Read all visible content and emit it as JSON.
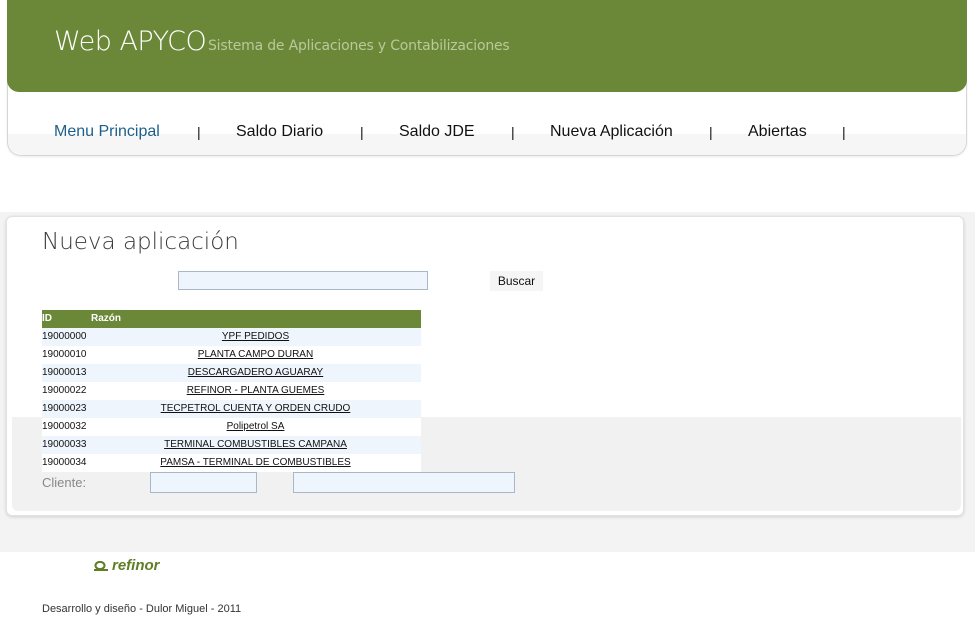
{
  "header": {
    "app_title": "Web APYCO",
    "app_subtitle": "Sistema de Aplicaciones y Contabilizaciones"
  },
  "nav": {
    "items": [
      {
        "label": "Menu Principal",
        "active": true
      },
      {
        "label": "Saldo Diario",
        "active": false
      },
      {
        "label": "Saldo JDE",
        "active": false
      },
      {
        "label": "Nueva Aplicación",
        "active": false
      },
      {
        "label": "Abiertas",
        "active": false
      }
    ],
    "separator": "|"
  },
  "page": {
    "title": "Nueva aplicación",
    "search_value": "",
    "search_button": "Buscar"
  },
  "table": {
    "columns": [
      "ID",
      "Razón"
    ],
    "rows": [
      {
        "id": "19000000",
        "name": "YPF PEDIDOS"
      },
      {
        "id": "19000010",
        "name": "PLANTA CAMPO DURAN"
      },
      {
        "id": "19000013",
        "name": "DESCARGADERO AGUARAY"
      },
      {
        "id": "19000022",
        "name": "REFINOR - PLANTA GUEMES"
      },
      {
        "id": "19000023",
        "name": "TECPETROL  CUENTA Y ORDEN CRUDO"
      },
      {
        "id": "19000032",
        "name": "Polipetrol SA"
      },
      {
        "id": "19000033",
        "name": "TERMINAL COMBUSTIBLES CAMPANA"
      },
      {
        "id": "19000034",
        "name": "PAMSA - TERMINAL DE COMBUSTIBLES"
      }
    ]
  },
  "cliente": {
    "label": "Cliente:",
    "code_value": "",
    "name_value": ""
  },
  "footer": {
    "logo_text": "refinor",
    "credit": "Desarrollo y diseño - Dulor Miguel - 2011"
  },
  "colors": {
    "brand_green": "#6b8839",
    "active_link": "#1b5f8a",
    "input_bg": "#eef5fc"
  }
}
